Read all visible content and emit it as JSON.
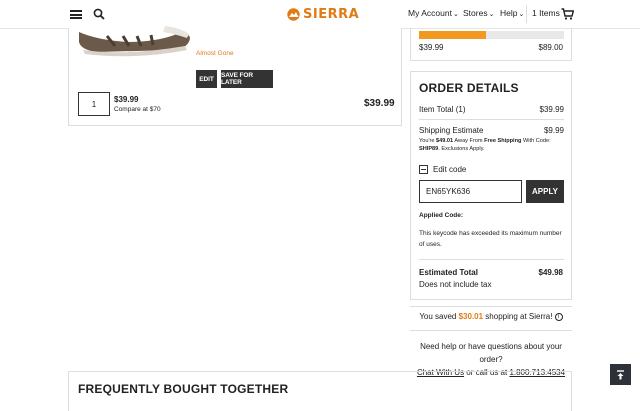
{
  "header": {
    "brand": "SIERRA",
    "nav": [
      {
        "label": "My Account"
      },
      {
        "label": "Stores"
      },
      {
        "label": "Help"
      }
    ],
    "cart_label": "1 Items"
  },
  "product": {
    "stock_note": "Almost Gone",
    "edit_label": "EDIT",
    "save_label": "SAVE FOR LATER",
    "quantity": "1",
    "unit_price": "$39.99",
    "compare": "Compare at $70",
    "line_total": "$39.99"
  },
  "shipping_progress": {
    "fraction": 0.46,
    "min_label": "$39.99",
    "max_label": "$89.00"
  },
  "order": {
    "title": "ORDER DETAILS",
    "item_total_label": "Item Total (1)",
    "item_total_value": "$39.99",
    "shipping_label": "Shipping Estimate",
    "shipping_value": "$9.99",
    "ship_note_a": "You're ",
    "ship_note_amount": "$49.01",
    "ship_note_b": " Away From ",
    "ship_note_free": "Free Shipping",
    "ship_note_c": " With Code: ",
    "ship_note_code": "SHIP89",
    "ship_note_d": ". Exclusions Apply.",
    "edit_code_label": "Edit code",
    "code_value": "EN65YK636",
    "apply_label": "APPLY",
    "applied_label": "Applied Code:",
    "applied_message": "This keycode has exceeded its maximum number of uses.",
    "estimated_label": "Estimated Total",
    "estimated_value": "$49.98",
    "tax_note": "Does not include tax"
  },
  "savings": {
    "prefix": "You saved ",
    "amount": "$30.01",
    "suffix": " shopping at Sierra!",
    "info_glyph": "i"
  },
  "help": {
    "question": "Need help or have questions about your order?",
    "chat_label": "Chat With Us",
    "or_text": " or call us at ",
    "phone": "1.800.713.4534"
  },
  "fbt_title": "FREQUENTLY BOUGHT TOGETHER",
  "colors": {
    "accent": "#e07b16",
    "progress": "#f29a1f",
    "dark": "#333333"
  },
  "icons": [
    "menu-icon",
    "search-icon",
    "sierra-logo-icon",
    "cart-icon",
    "back-to-top-icon"
  ]
}
